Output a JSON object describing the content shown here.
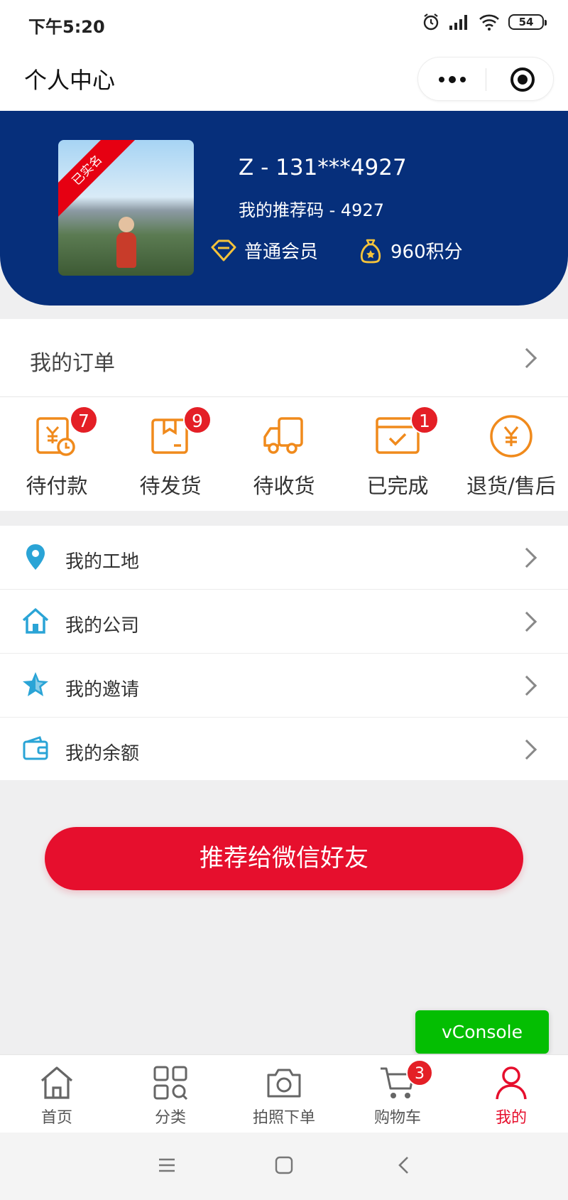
{
  "status": {
    "time": "下午5:20",
    "battery": "54"
  },
  "nav": {
    "title": "个人中心"
  },
  "profile": {
    "ribbon": "已实名",
    "name": "Z - 131***4927",
    "referral": "我的推荐码 - 4927",
    "member_level": "普通会员",
    "points": "960积分"
  },
  "orders": {
    "title": "我的订单",
    "items": [
      {
        "label": "待付款",
        "badge": "7"
      },
      {
        "label": "待发货",
        "badge": "9"
      },
      {
        "label": "待收货",
        "badge": ""
      },
      {
        "label": "已完成",
        "badge": "1"
      },
      {
        "label": "退货/售后",
        "badge": ""
      }
    ]
  },
  "menu": [
    {
      "label": "我的工地"
    },
    {
      "label": "我的公司"
    },
    {
      "label": "我的邀请"
    },
    {
      "label": "我的余额"
    }
  ],
  "share_button": "推荐给微信好友",
  "vconsole": "vConsole",
  "tabs": [
    {
      "label": "首页"
    },
    {
      "label": "分类"
    },
    {
      "label": "拍照下单"
    },
    {
      "label": "购物车",
      "badge": "3"
    },
    {
      "label": "我的"
    }
  ],
  "colors": {
    "brand_blue": "#062f7b",
    "accent_red": "#e60f2d",
    "icon_orange": "#f08a1c",
    "icon_blue": "#2aa4d6",
    "gold": "#f5c33b"
  }
}
